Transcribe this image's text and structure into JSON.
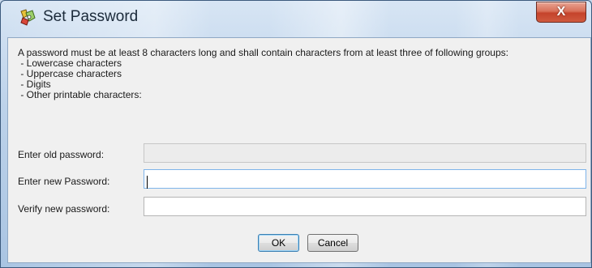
{
  "window": {
    "title": "Set Password",
    "close_glyph": "X"
  },
  "description": {
    "intro": "A password must be at least 8 characters long and shall contain characters from at least three of following groups:",
    "groups": [
      " - Lowercase characters",
      " - Uppercase characters",
      " - Digits",
      " - Other printable characters:"
    ]
  },
  "form": {
    "old_password": {
      "label": "Enter old password:",
      "value": "",
      "enabled": false
    },
    "new_password": {
      "label": "Enter new Password:",
      "value": "",
      "focused": true
    },
    "verify_password": {
      "label": "Verify new password:",
      "value": ""
    }
  },
  "buttons": {
    "ok": "OK",
    "cancel": "Cancel"
  },
  "icons": {
    "app": "password-tool-icon",
    "close": "close-icon"
  }
}
